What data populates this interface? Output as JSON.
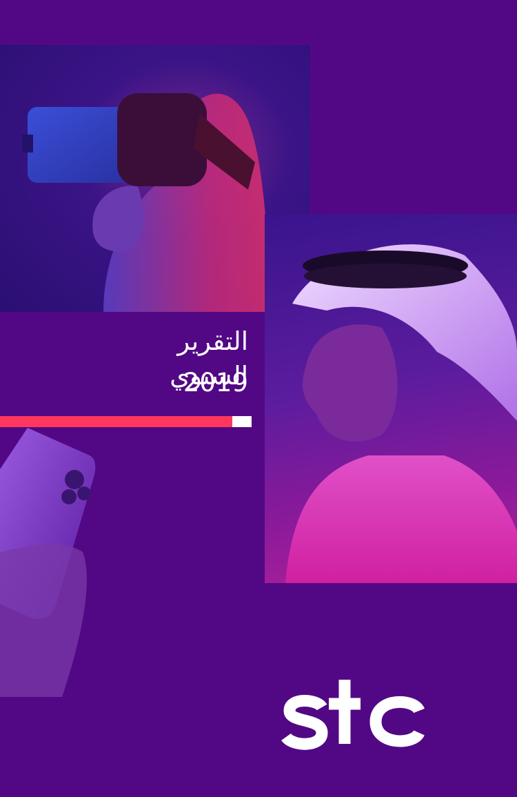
{
  "cover": {
    "title": "التقرير السنوي",
    "year": "2019",
    "logo_text": "stc"
  },
  "colors": {
    "background": "#520884",
    "accent_bar": "#ff375e",
    "text": "#ffffff"
  },
  "images": {
    "vr": "woman-with-vr-headset-photo",
    "man": "man-in-ghutra-photo",
    "phone": "hand-holding-phone-photo"
  }
}
